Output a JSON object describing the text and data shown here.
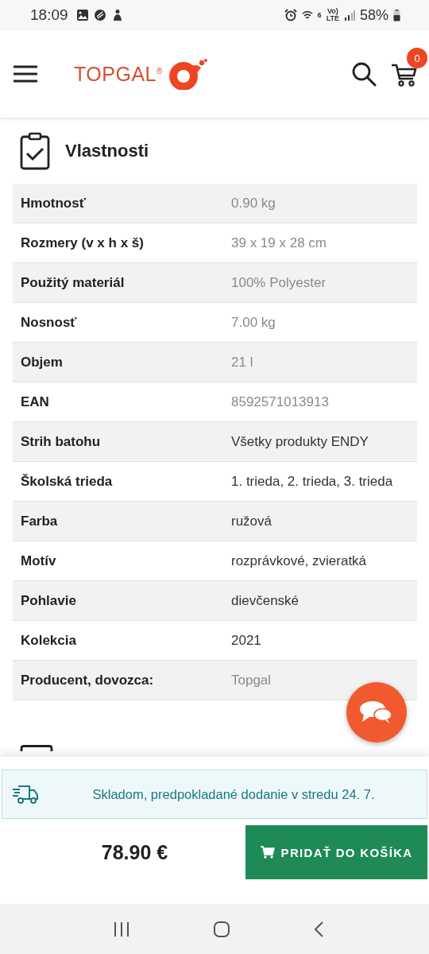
{
  "status_bar": {
    "time": "18:09",
    "wifi_label": "6",
    "volte_label": "Vo)",
    "lte_label": "LTE",
    "battery": "58%"
  },
  "header": {
    "logo": "TOPGAL$^{®}$",
    "cart_count": "0"
  },
  "section": {
    "title": "Vlastnosti"
  },
  "properties": [
    {
      "label": "Hmotnosť",
      "value": "0.90 kg",
      "muted": true
    },
    {
      "label": "Rozmery (v x h x š)",
      "value": "39 x 19 x 28 cm",
      "muted": true
    },
    {
      "label": "Použitý materiál",
      "value": "100% Polyester",
      "muted": true
    },
    {
      "label": "Nosnosť",
      "value": "7.00 kg",
      "muted": true
    },
    {
      "label": "Objem",
      "value": "21 l",
      "muted": true
    },
    {
      "label": "EAN",
      "value": "8592571013913",
      "muted": true
    },
    {
      "label": "Strih batohu",
      "value": "Všetky produkty ENDY",
      "muted": false
    },
    {
      "label": "Školská trieda",
      "value": "1. trieda, 2. trieda, 3. trieda",
      "muted": false
    },
    {
      "label": "Farba",
      "value": "ružová",
      "muted": false
    },
    {
      "label": "Motív",
      "value": "rozprávkové, zvieratká",
      "muted": false
    },
    {
      "label": "Pohlavie",
      "value": "dievčenské",
      "muted": false
    },
    {
      "label": "Kolekcia",
      "value": "2021",
      "muted": false
    },
    {
      "label": "Producent, dovozca:",
      "value": "Topgal",
      "muted": true
    }
  ],
  "availability": {
    "text": "Skladom, predpokladané dodanie v stredu 24. 7."
  },
  "purchase": {
    "price": "78.90 €",
    "button": "PRIDAŤ DO KOŠÍKA"
  }
}
